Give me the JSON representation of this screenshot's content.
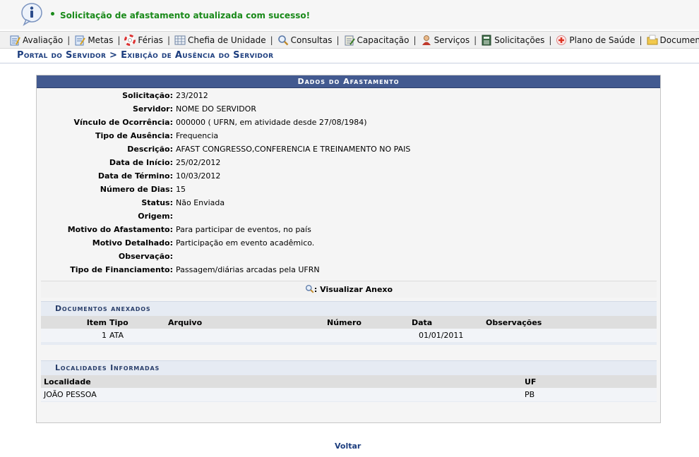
{
  "message": {
    "icon": "info-icon",
    "text": "Solicitação de afastamento atualizada com sucesso!",
    "color": "#1a8a1a"
  },
  "menu": [
    {
      "label": "Avaliação",
      "icon": "evaluation-icon"
    },
    {
      "label": "Metas",
      "icon": "goals-icon"
    },
    {
      "label": "Férias",
      "icon": "vacation-lifebuoy-icon"
    },
    {
      "label": "Chefia de Unidade",
      "icon": "unit-chief-icon"
    },
    {
      "label": "Consultas",
      "icon": "magnifier-icon"
    },
    {
      "label": "Capacitação",
      "icon": "training-icon"
    },
    {
      "label": "Serviços",
      "icon": "person-services-icon"
    },
    {
      "label": "Solicitações",
      "icon": "requests-book-icon"
    },
    {
      "label": "Plano de Saúde",
      "icon": "health-cross-icon"
    },
    {
      "label": "Documentos",
      "icon": "documents-folder-icon"
    }
  ],
  "breadcrumb": "Portal do Servidor > Exibição de Ausência do Servidor",
  "panel": {
    "caption": "Dados do Afastamento",
    "fields": [
      {
        "label": "Solicitação:",
        "value": "23/2012"
      },
      {
        "label": "Servidor:",
        "value": "NOME DO SERVIDOR"
      },
      {
        "label": "Vínculo de Ocorrência:",
        "value": "000000 ( UFRN, em atividade desde 27/08/1984)"
      },
      {
        "label": "Tipo de Ausência:",
        "value": "Frequencia"
      },
      {
        "label": "Descrição:",
        "value": "AFAST CONGRESSO,CONFERENCIA E TREINAMENTO NO PAIS"
      },
      {
        "label": "Data de Início:",
        "value": "25/02/2012"
      },
      {
        "label": "Data de Término:",
        "value": "10/03/2012"
      },
      {
        "label": "Número de Dias:",
        "value": "15"
      },
      {
        "label": "Status:",
        "value": "Não Enviada"
      },
      {
        "label": "Origem:",
        "value": ""
      },
      {
        "label": "Motivo do Afastamento:",
        "value": "Para participar de eventos, no país"
      },
      {
        "label": "Motivo Detalhado:",
        "value": "Participação em evento acadêmico."
      },
      {
        "label": "Observação:",
        "value": ""
      },
      {
        "label": "Tipo de Financiamento:",
        "value": "Passagem/diárias arcadas pela UFRN"
      }
    ],
    "view_attachment": ": Visualizar Anexo",
    "documents": {
      "title": "Documentos anexados",
      "headers": {
        "item": "Item",
        "tipo": "Tipo",
        "arquivo": "Arquivo",
        "numero": "Número",
        "data": "Data",
        "observacoes": "Observações"
      },
      "rows": [
        {
          "item": "1",
          "tipo": "ATA",
          "arquivo": "",
          "numero": "",
          "data": "01/01/2011",
          "observacoes": ""
        }
      ]
    },
    "localities": {
      "title": "Localidades Informadas",
      "headers": {
        "localidade": "Localidade",
        "uf": "UF"
      },
      "rows": [
        {
          "localidade": "JOÃO PESSOA",
          "uf": "PB"
        }
      ]
    }
  },
  "back_link": "Voltar",
  "colors": {
    "header_blue": "#435a90",
    "link_blue": "#1c3d7e",
    "success_green": "#1a8a1a"
  }
}
